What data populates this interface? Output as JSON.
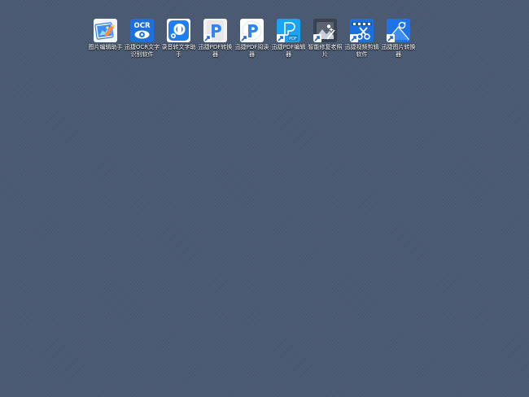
{
  "desktop": {
    "background": "#4a5a72",
    "shortcuts": [
      {
        "label": "图片编辑助手",
        "icon": "image-editor-icon",
        "color": "#2b7de0",
        "has_shortcut_arrow": false
      },
      {
        "label": "迅捷OCR文字识别软件",
        "icon": "ocr-eye-icon",
        "color": "#1e6fd9",
        "has_shortcut_arrow": false
      },
      {
        "label": "录音转文字助手",
        "icon": "audio-to-text-icon",
        "color": "#1f7ef0",
        "has_shortcut_arrow": false
      },
      {
        "label": "迅捷PDF转换器",
        "icon": "pdf-converter-icon",
        "color": "#2f86f2",
        "has_shortcut_arrow": true
      },
      {
        "label": "迅捷PDF阅读器",
        "icon": "pdf-reader-icon",
        "color": "#2f86f2",
        "has_shortcut_arrow": true
      },
      {
        "label": "迅捷PDF编辑器",
        "icon": "pdf-editor-icon",
        "color": "#1aa3f0",
        "has_shortcut_arrow": true
      },
      {
        "label": "智能修复老照片",
        "icon": "photo-restore-icon",
        "color": "#3a4150",
        "has_shortcut_arrow": true
      },
      {
        "label": "迅捷视频剪辑软件",
        "icon": "video-cut-icon",
        "color": "#1d6fe0",
        "has_shortcut_arrow": true
      },
      {
        "label": "迅捷图片转换器",
        "icon": "image-converter-icon",
        "color": "#1f73ea",
        "has_shortcut_arrow": true
      }
    ]
  }
}
